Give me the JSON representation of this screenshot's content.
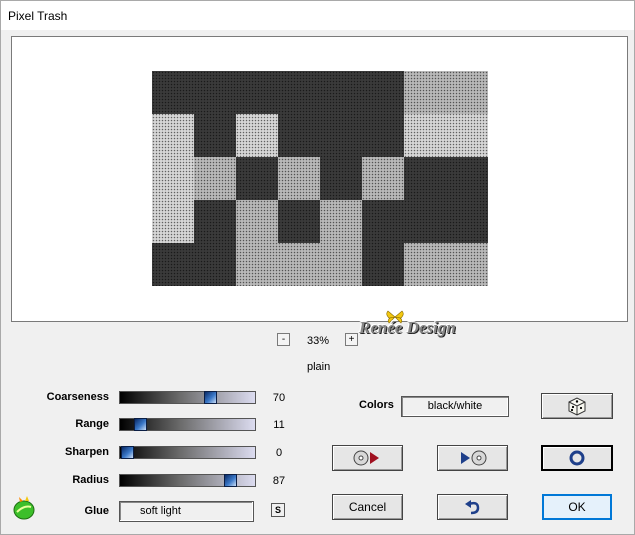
{
  "window": {
    "title": "Pixel Trash"
  },
  "preview": {
    "zoom": "33%",
    "zoom_minus": "-",
    "zoom_plus": "+",
    "mode": "plain"
  },
  "watermark": {
    "text": "Renée Design"
  },
  "params": [
    {
      "label": "Coarseness",
      "value": "70",
      "fraction": 0.7
    },
    {
      "label": "Range",
      "value": "11",
      "fraction": 0.11
    },
    {
      "label": "Sharpen",
      "value": "0",
      "fraction": 0.0
    },
    {
      "label": "Radius",
      "value": "87",
      "fraction": 0.87
    }
  ],
  "glue": {
    "label": "Glue",
    "value": "soft light",
    "s_button": "S"
  },
  "colors": {
    "label": "Colors",
    "value": "black/white"
  },
  "buttons": {
    "cancel": "Cancel",
    "ok": "OK"
  },
  "icons": {
    "dice": "dice-icon",
    "load": "load-preset-icon",
    "save": "save-preset-icon",
    "preview_toggle": "preview-toggle-icon",
    "undo": "undo-icon",
    "logo": "leaf-logo-icon"
  }
}
